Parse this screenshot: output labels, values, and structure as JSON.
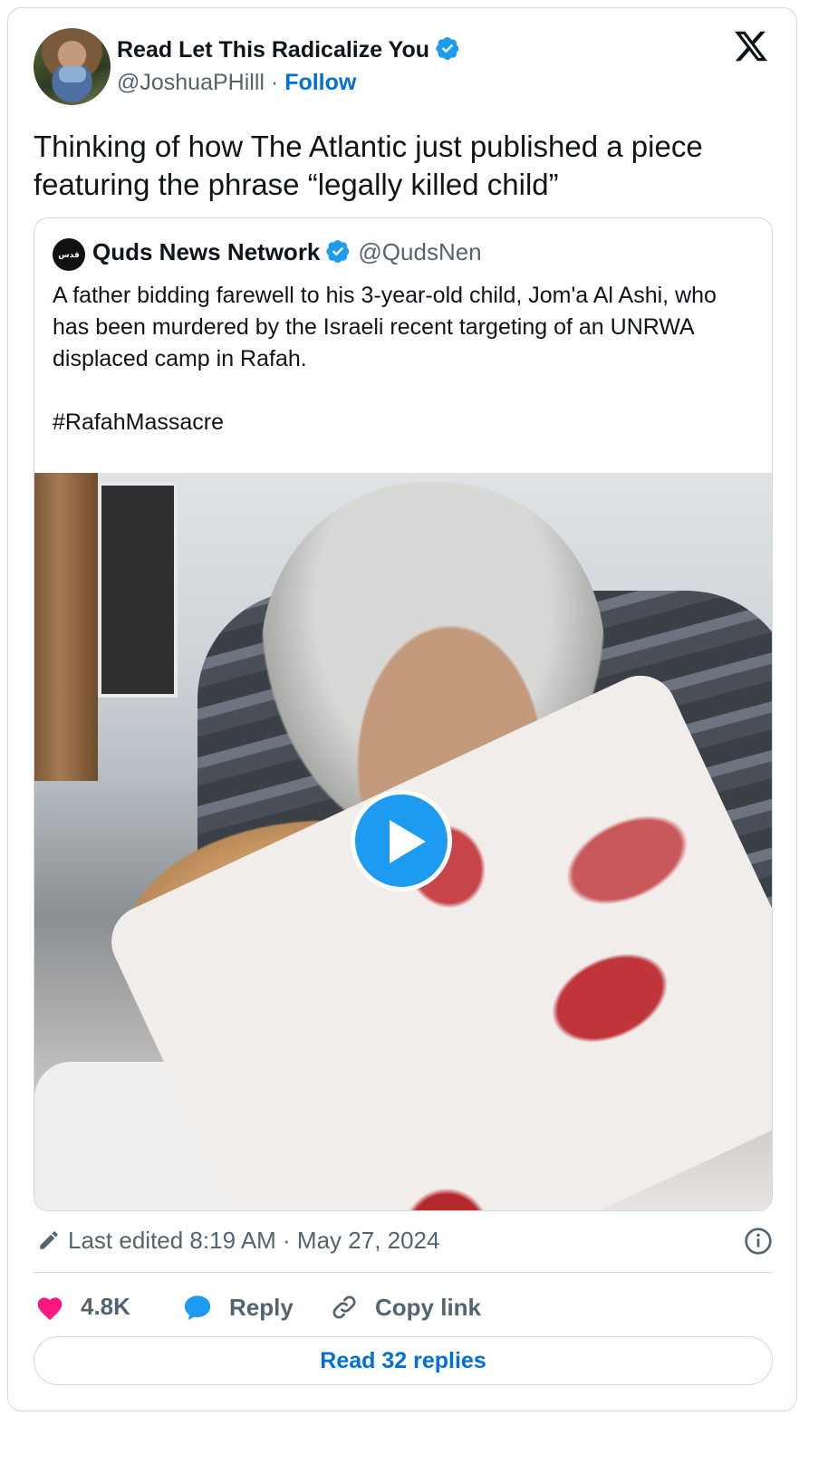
{
  "author": {
    "name": "Read Let This Radicalize You",
    "handle": "@JoshuaPHilll",
    "separator": "·",
    "follow_label": "Follow"
  },
  "tweet": {
    "text": "Thinking of how The Atlantic just published a piece featuring the phrase “legally killed child”"
  },
  "quoted": {
    "avatar_text": "قدس",
    "name": "Quds News Network",
    "handle": "@QudsNen",
    "text": "A father bidding farewell to his 3-year-old child, Jom'a Al Ashi, who has been murdered by the Israeli recent targeting of an UNRWA displaced camp in Rafah.\n\n#RafahMassacre"
  },
  "meta": {
    "edited_label": "Last edited 8:19 AM · May 27, 2024"
  },
  "actions": {
    "likes": "4.8K",
    "reply_label": "Reply",
    "copy_label": "Copy link",
    "read_replies_label": "Read 32 replies"
  },
  "colors": {
    "accent": "#1d9bf0",
    "link": "#006fd6",
    "like": "#f91880",
    "muted": "#536471"
  },
  "icons": [
    "verified-icon",
    "x-logo-icon",
    "play-icon",
    "edit-icon",
    "info-icon",
    "heart-icon",
    "reply-icon",
    "link-icon"
  ]
}
